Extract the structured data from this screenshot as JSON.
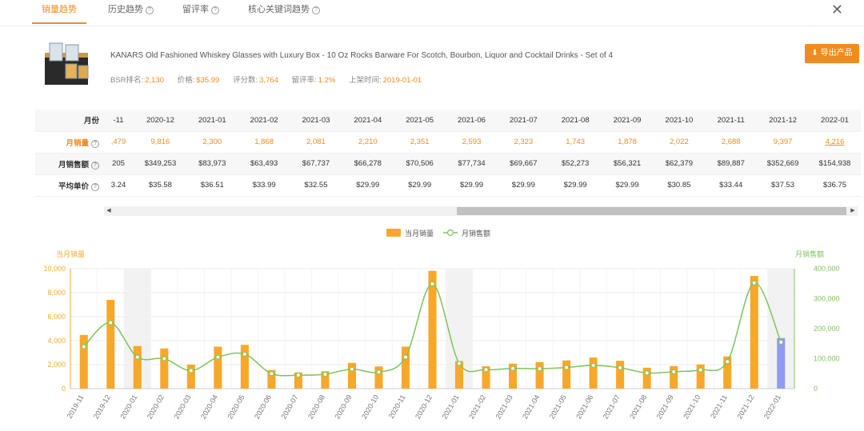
{
  "tabs": [
    {
      "label": "销量趋势",
      "help": false
    },
    {
      "label": "历史趋势",
      "help": true
    },
    {
      "label": "留评率",
      "help": true
    },
    {
      "label": "核心关键词趋势",
      "help": true
    }
  ],
  "close_label": "✕",
  "product": {
    "title": "KANARS Old Fashioned Whiskey Glasses with Luxury Box - 10 Oz Rocks Barware For Scotch, Bourbon, Liquor and Cocktail Drinks - Set of 4",
    "meta": [
      {
        "label": "BSR排名:",
        "value": "2,130"
      },
      {
        "label": "价格:",
        "value": "$35.99"
      },
      {
        "label": "评分数:",
        "value": "3,764"
      },
      {
        "label": "留评率:",
        "value": "1.2%"
      },
      {
        "label": "上架时间:",
        "value": "2019-01-01"
      }
    ],
    "export_label": "导出产品"
  },
  "table": {
    "row_labels": [
      "月份",
      "月销量",
      "月销售额",
      "平均单价"
    ],
    "months": [
      "-11",
      "2020-12",
      "2021-01",
      "2021-02",
      "2021-03",
      "2021-04",
      "2021-05",
      "2021-06",
      "2021-07",
      "2021-08",
      "2021-09",
      "2021-10",
      "2021-11",
      "2021-12",
      "2022-01"
    ],
    "sales": [
      ",479",
      "9,816",
      "2,300",
      "1,868",
      "2,081",
      "2,210",
      "2,351",
      "2,593",
      "2,323",
      "1,743",
      "1,878",
      "2,022",
      "2,688",
      "9,397",
      "4,216"
    ],
    "revenue": [
      "205",
      "$349,253",
      "$83,973",
      "$63,493",
      "$67,737",
      "$66,278",
      "$70,506",
      "$77,734",
      "$69,667",
      "$52,273",
      "$56,321",
      "$62,379",
      "$89,887",
      "$352,669",
      "$154,938"
    ],
    "avg_price": [
      "3.24",
      "$35.58",
      "$36.51",
      "$33.99",
      "$32.55",
      "$29.99",
      "$29.99",
      "$29.99",
      "$29.99",
      "$29.99",
      "$29.99",
      "$30.85",
      "$33.44",
      "$37.53",
      "$36.75"
    ]
  },
  "chart_data": {
    "type": "bar",
    "legend": [
      "当月销量",
      "月销售额"
    ],
    "legend_position": "top-center",
    "left_axis_title": "当月销量",
    "right_axis_title": "月销售额",
    "left_ticks": [
      "0",
      "2,000",
      "4,000",
      "6,000",
      "8,000",
      "10,000"
    ],
    "right_ticks": [
      "0",
      "100,000",
      "200,000",
      "300,000",
      "400,000"
    ],
    "ylim_left": [
      0,
      10000
    ],
    "ylim_right": [
      0,
      400000
    ],
    "categories": [
      "2019-11",
      "2019-12",
      "2020-01",
      "2020-02",
      "2020-03",
      "2020-04",
      "2020-05",
      "2020-06",
      "2020-07",
      "2020-08",
      "2020-09",
      "2020-10",
      "2020-11",
      "2020-12",
      "2021-01",
      "2021-02",
      "2021-03",
      "2021-04",
      "2021-05",
      "2021-06",
      "2021-07",
      "2021-08",
      "2021-09",
      "2021-10",
      "2021-11",
      "2021-12",
      "2022-01"
    ],
    "series": [
      {
        "name": "当月销量",
        "type": "bar",
        "axis": "left",
        "values": [
          4479,
          7400,
          3550,
          3350,
          2000,
          3500,
          3650,
          1550,
          1350,
          1450,
          2150,
          1850,
          3500,
          9816,
          2300,
          1868,
          2081,
          2210,
          2351,
          2593,
          2323,
          1743,
          1878,
          2022,
          2688,
          9397,
          4216
        ]
      },
      {
        "name": "月销售额",
        "type": "line",
        "axis": "right",
        "values": [
          140000,
          220000,
          105000,
          100000,
          60000,
          105000,
          115000,
          50000,
          45000,
          48000,
          65000,
          55000,
          105000,
          349253,
          83973,
          63493,
          67737,
          66278,
          70506,
          77734,
          69667,
          52273,
          56321,
          62379,
          89887,
          352669,
          154938
        ]
      }
    ],
    "highlight_categories": [
      "2020-01",
      "2021-01",
      "2022-01"
    ],
    "colors": {
      "bar": "#f7a82a",
      "bar_latest": "#8f9cf0",
      "line": "#7dc55a",
      "left_axis": "#f7a82a",
      "right_axis": "#7dc55a",
      "highlight": "#f2f2f2"
    }
  }
}
